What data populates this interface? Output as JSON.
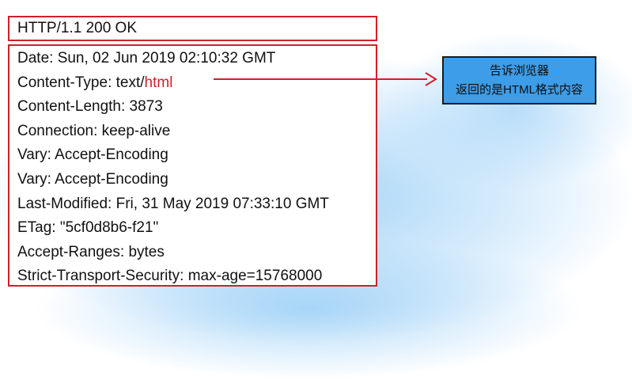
{
  "status_line": "HTTP/1.1 200 OK",
  "headers": [
    "Date: Sun, 02 Jun 2019 02:10:32 GMT",
    "Content-Type: text/",
    "Content-Length: 3873",
    "Connection: keep-alive",
    "Vary: Accept-Encoding",
    "Vary: Accept-Encoding",
    "Last-Modified: Fri, 31 May 2019 07:33:10 GMT",
    "ETag: \"5cf0d8b6-f21\"",
    "Accept-Ranges: bytes",
    "Strict-Transport-Security: max-age=15768000"
  ],
  "highlight": "html",
  "note": {
    "line1": "告诉浏览器",
    "line2": "返回的是HTML格式内容"
  },
  "colors": {
    "box_border": "#d21f2a",
    "highlight_text": "#d21f2a",
    "arrow": "#d21f2a",
    "note_fill": "#3d9de8",
    "background_glow": "#a9d6f7"
  }
}
